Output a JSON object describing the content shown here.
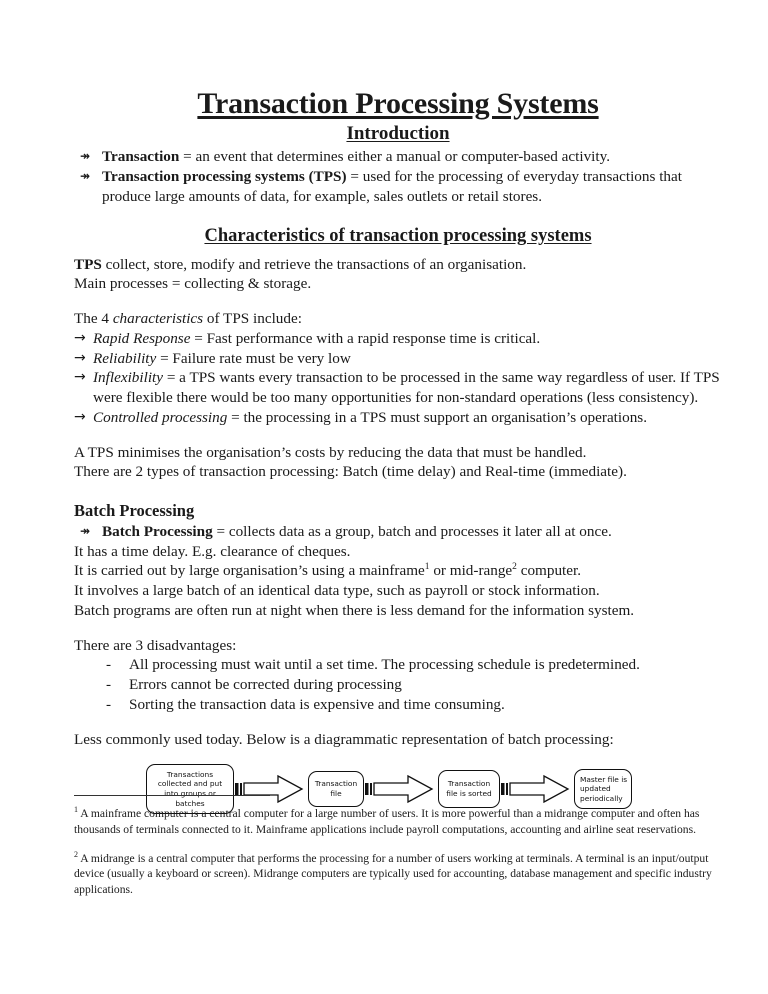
{
  "document": {
    "title": "Transaction Processing Systems",
    "intro_heading": "Introduction",
    "intro_bullets": [
      {
        "term": "Transaction",
        "definition": " = an event that determines either a manual or computer-based activity."
      },
      {
        "term": "Transaction processing systems (TPS)",
        "definition": " = used for the processing of everyday transactions that produce large amounts of data, for example, sales outlets or retail stores."
      }
    ],
    "characteristics": {
      "heading": "Characteristics of transaction processing systems",
      "lead_bold": "TPS",
      "lead_rest": " collect, store, modify and retrieve the transactions of an organisation.",
      "main_processes": "Main processes = collecting & storage.",
      "intro_pre": "The 4 ",
      "intro_ital": "characteristics",
      "intro_post": " of TPS include:",
      "items": [
        {
          "name": "Rapid Response",
          "text": " = Fast performance with a rapid response time is critical."
        },
        {
          "name": "Reliability",
          "text": " = Failure rate must be very low"
        },
        {
          "name": "Inflexibility",
          "text": " = a TPS wants every transaction to be processed in the same way regardless of user. If TPS were flexible there would be too many opportunities for non-standard operations (less consistency)."
        },
        {
          "name": "Controlled processing",
          "text": " = the processing in a TPS must support an organisation’s operations."
        }
      ],
      "closing_line_1": "A TPS minimises the organisation’s costs by reducing the data that must be handled.",
      "closing_line_2": "There are 2 types of transaction processing: Batch (time delay) and Real-time (immediate)."
    },
    "batch": {
      "heading": "Batch Processing",
      "bullet_term": "Batch Processing",
      "bullet_definition": " = collects data as a group, batch and processes it later all at once.",
      "line_time_delay": "It has a time delay. E.g. clearance of cheques.",
      "line_carried_pre": "It is carried out by large organisation’s using a mainframe",
      "line_carried_sup1": "1",
      "line_carried_mid": " or mid-range",
      "line_carried_sup2": "2",
      "line_carried_post": " computer.",
      "line_involves": "It involves a large batch of an identical data type, such as payroll or stock information.",
      "line_night": "Batch programs are often run at night when there is less demand for the information system.",
      "disadvantages_heading": "There are 3 disadvantages:",
      "disadvantages": [
        "All processing must wait until a set time. The processing schedule is predetermined.",
        "Errors cannot be corrected during processing",
        "Sorting the transaction data is expensive and time consuming."
      ],
      "dash_mark": "-",
      "diagram_intro": "Less commonly used today. Below is a diagrammatic representation of batch processing:"
    },
    "diagram": {
      "stages": [
        "Transactions collected and put into groups or batches",
        "Transaction file",
        "Transaction file is sorted",
        "Master file is updated periodically"
      ],
      "arrow_count": 3
    },
    "footnotes": [
      {
        "marker": "1",
        "text": " A mainframe computer is a central computer for a large number of users. It is more powerful than a midrange computer and often has thousands of terminals connected to it. Mainframe applications include payroll computations, accounting and airline seat reservations."
      },
      {
        "marker": "2",
        "text": " A midrange is a central computer that performs the processing for a number of users working at terminals. A terminal is an input/output device (usually a keyboard or screen). Midrange computers are typically used for accounting, database management and specific industry applications."
      }
    ],
    "glyphs": {
      "wingding_bullet": "↠",
      "arrow": "→"
    }
  }
}
